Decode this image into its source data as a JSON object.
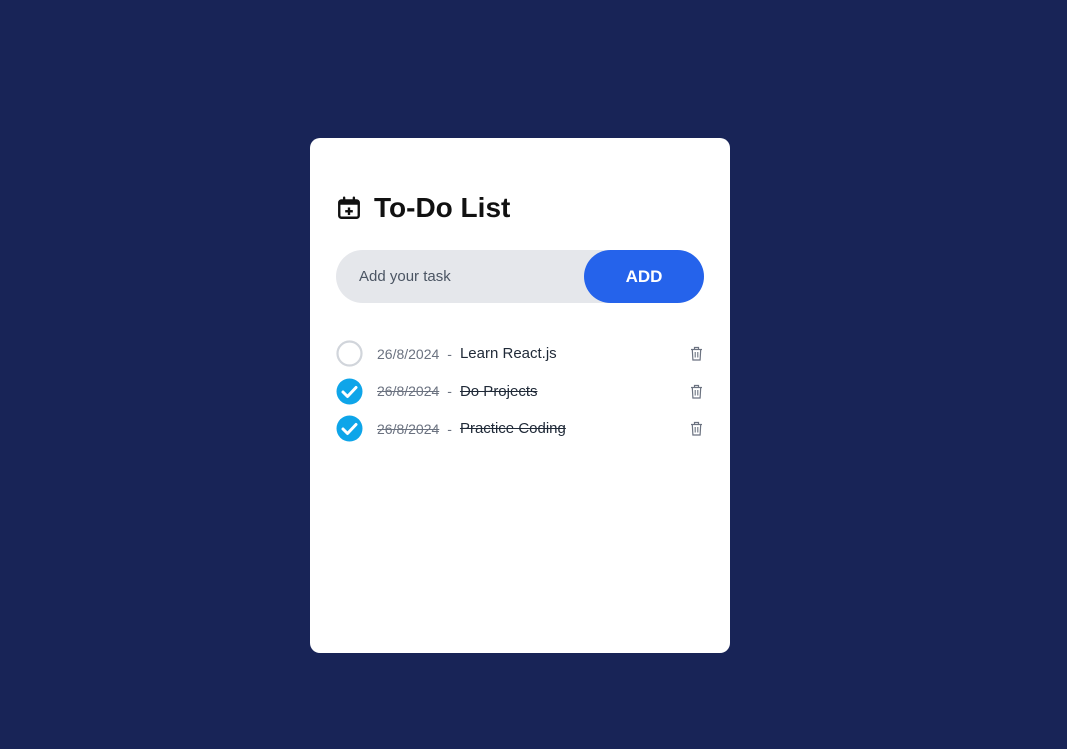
{
  "app": {
    "title": "To-Do List",
    "header_icon": "calendar-plus-icon"
  },
  "input": {
    "placeholder": "Add your task",
    "value": ""
  },
  "add_button": {
    "label": "ADD"
  },
  "colors": {
    "background": "#182457",
    "card": "#ffffff",
    "accent": "#2563eb",
    "check": "#0ea5e9",
    "input_bg": "#e5e7eb"
  },
  "separator": "-",
  "tasks": [
    {
      "date": "26/8/2024",
      "text": "Learn React.js",
      "done": false
    },
    {
      "date": "26/8/2024",
      "text": "Do Projects",
      "done": true
    },
    {
      "date": "26/8/2024",
      "text": "Practice Coding",
      "done": true
    }
  ]
}
